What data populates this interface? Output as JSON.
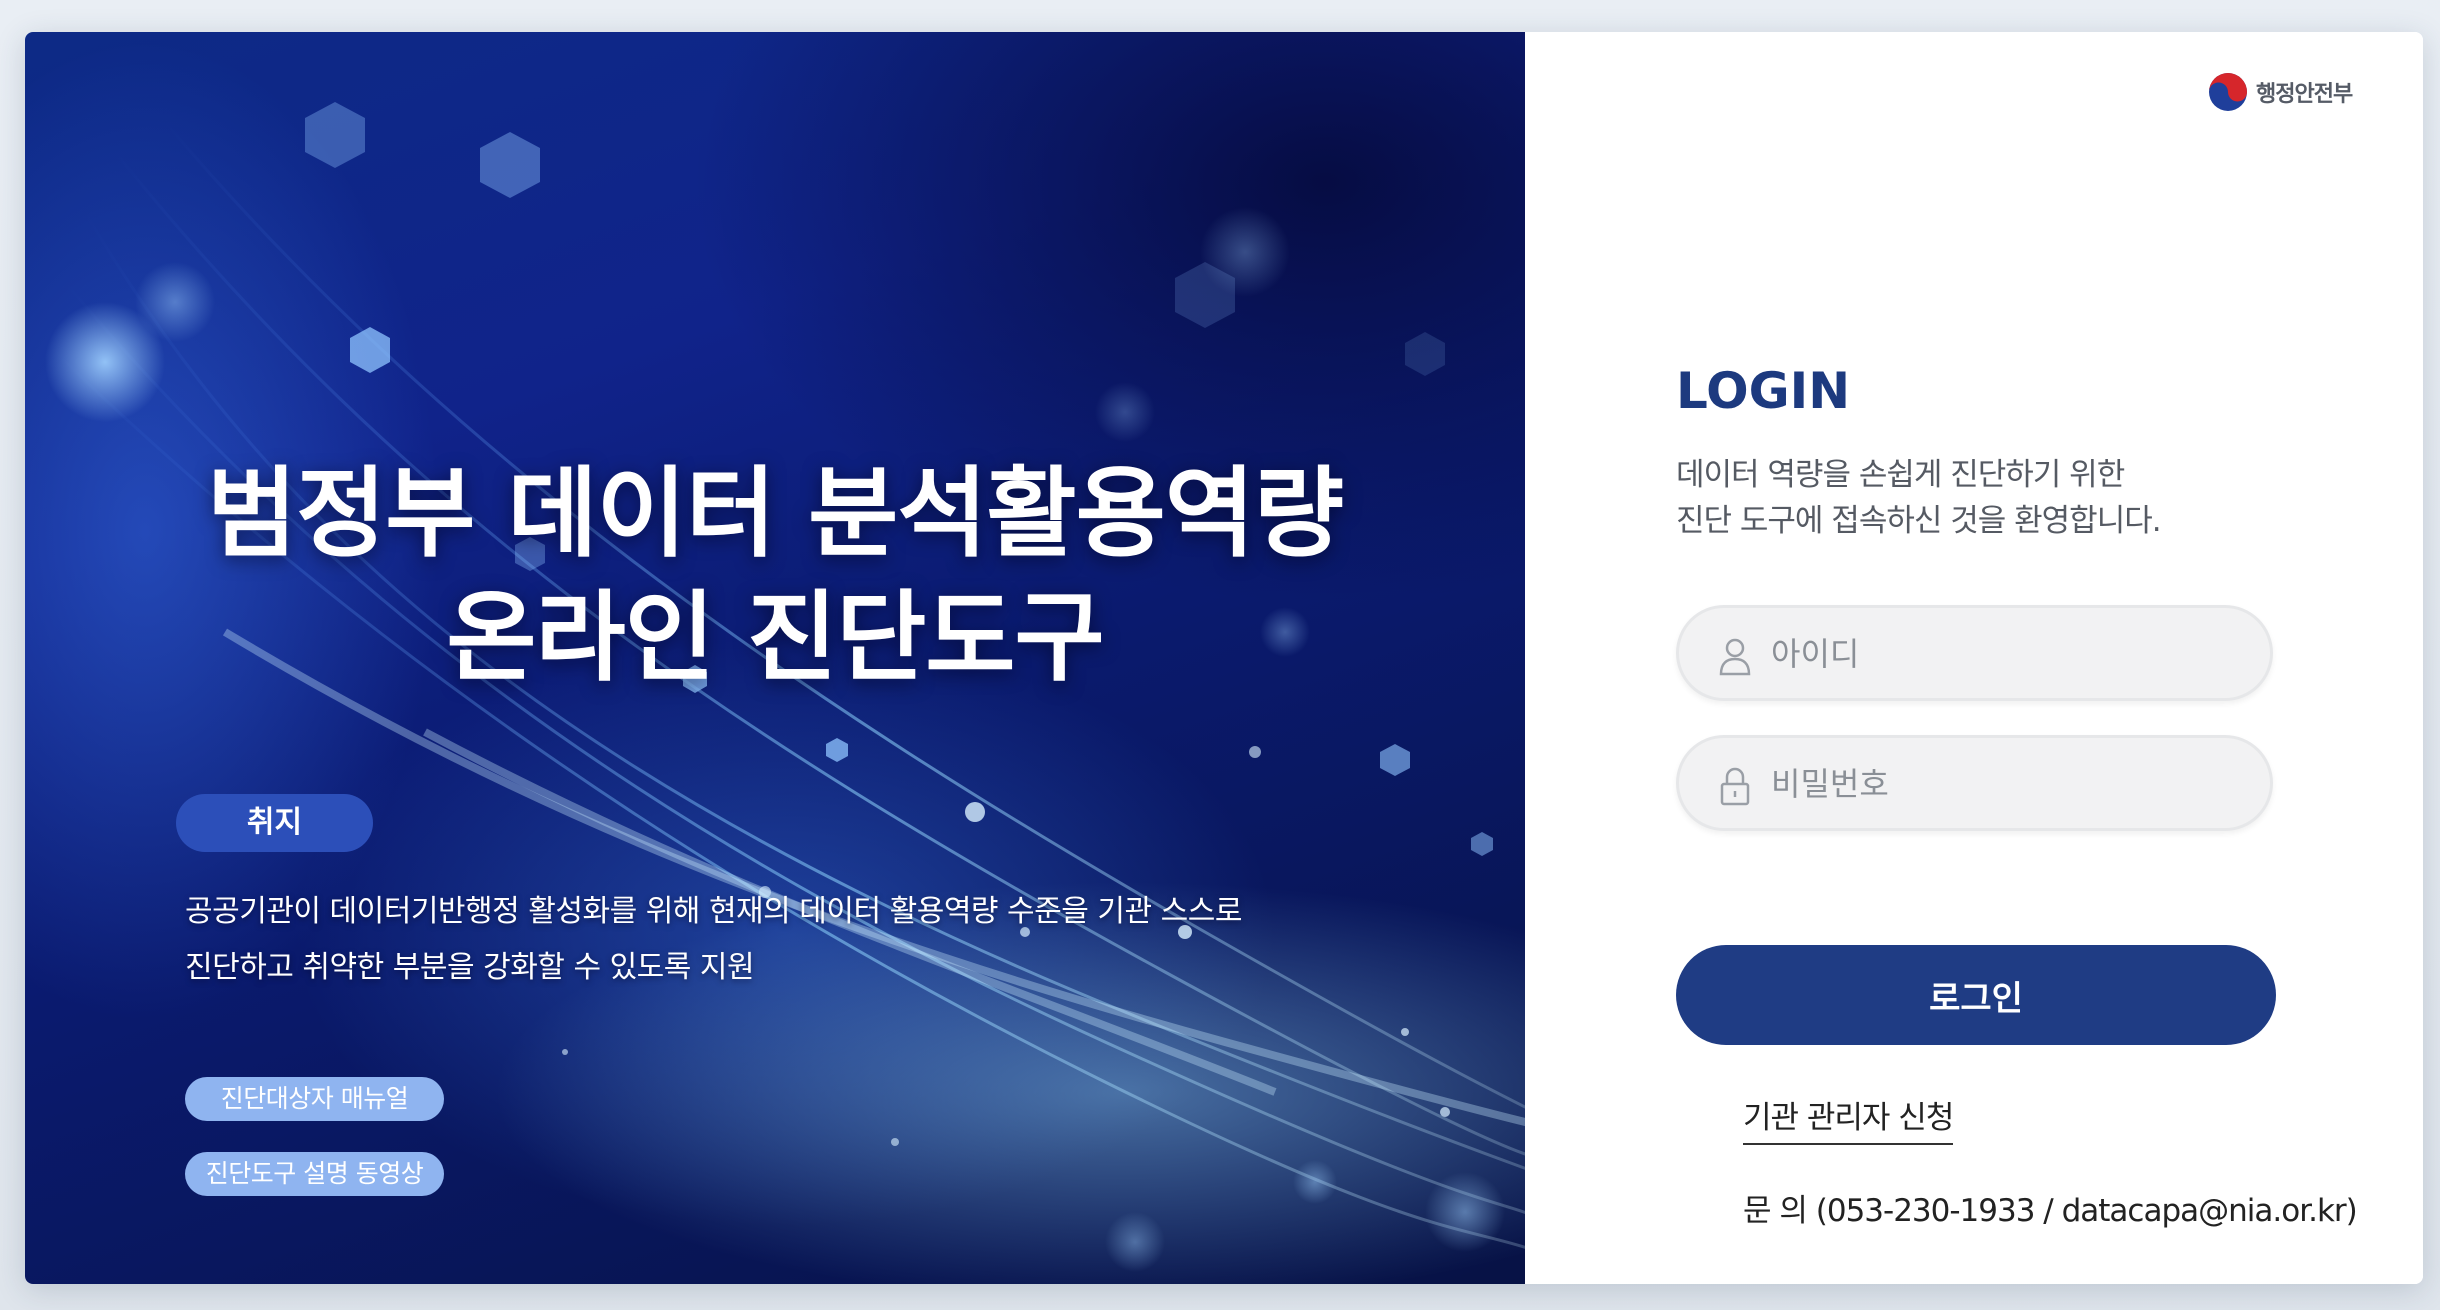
{
  "hero": {
    "title_line1": "범정부 데이터 분석활용역량",
    "title_line2": "온라인 진단도구",
    "purpose_badge": "취지",
    "purpose_line1": "공공기관이 데이터기반행정 활성화를 위해 현재의 데이터 활용역량 수준을 기관 스스로",
    "purpose_line2": "진단하고 취약한 부분을 강화할 수 있도록 지원",
    "manual_button": "진단대상자 매뉴얼",
    "video_button": "진단도구 설명 동영상"
  },
  "panel": {
    "ministry_name": "행정안전부",
    "login_title": "LOGIN",
    "welcome_line1": "데이터 역량을 손쉽게 진단하기 위한",
    "welcome_line2": "진단 도구에 접속하신 것을 환영합니다.",
    "id_field": {
      "placeholder": "아이디",
      "value": ""
    },
    "password_field": {
      "placeholder": "비밀번호",
      "value": ""
    },
    "login_button": "로그인",
    "admin_apply_link": "기관 관리자 신청",
    "contact": "문 의 (053-230-1933 / datacapa@nia.or.kr)"
  },
  "icons": {
    "ministry_logo": "taegeuk-logo-icon",
    "id_field": "user-icon",
    "password_field": "lock-icon"
  },
  "colors": {
    "primary": "#1f3c84",
    "login_title": "#1d3a7f",
    "purpose_badge": "#2c4fb9",
    "hero_button": "#8fb4f0",
    "field_bg": "#f2f2f3"
  }
}
